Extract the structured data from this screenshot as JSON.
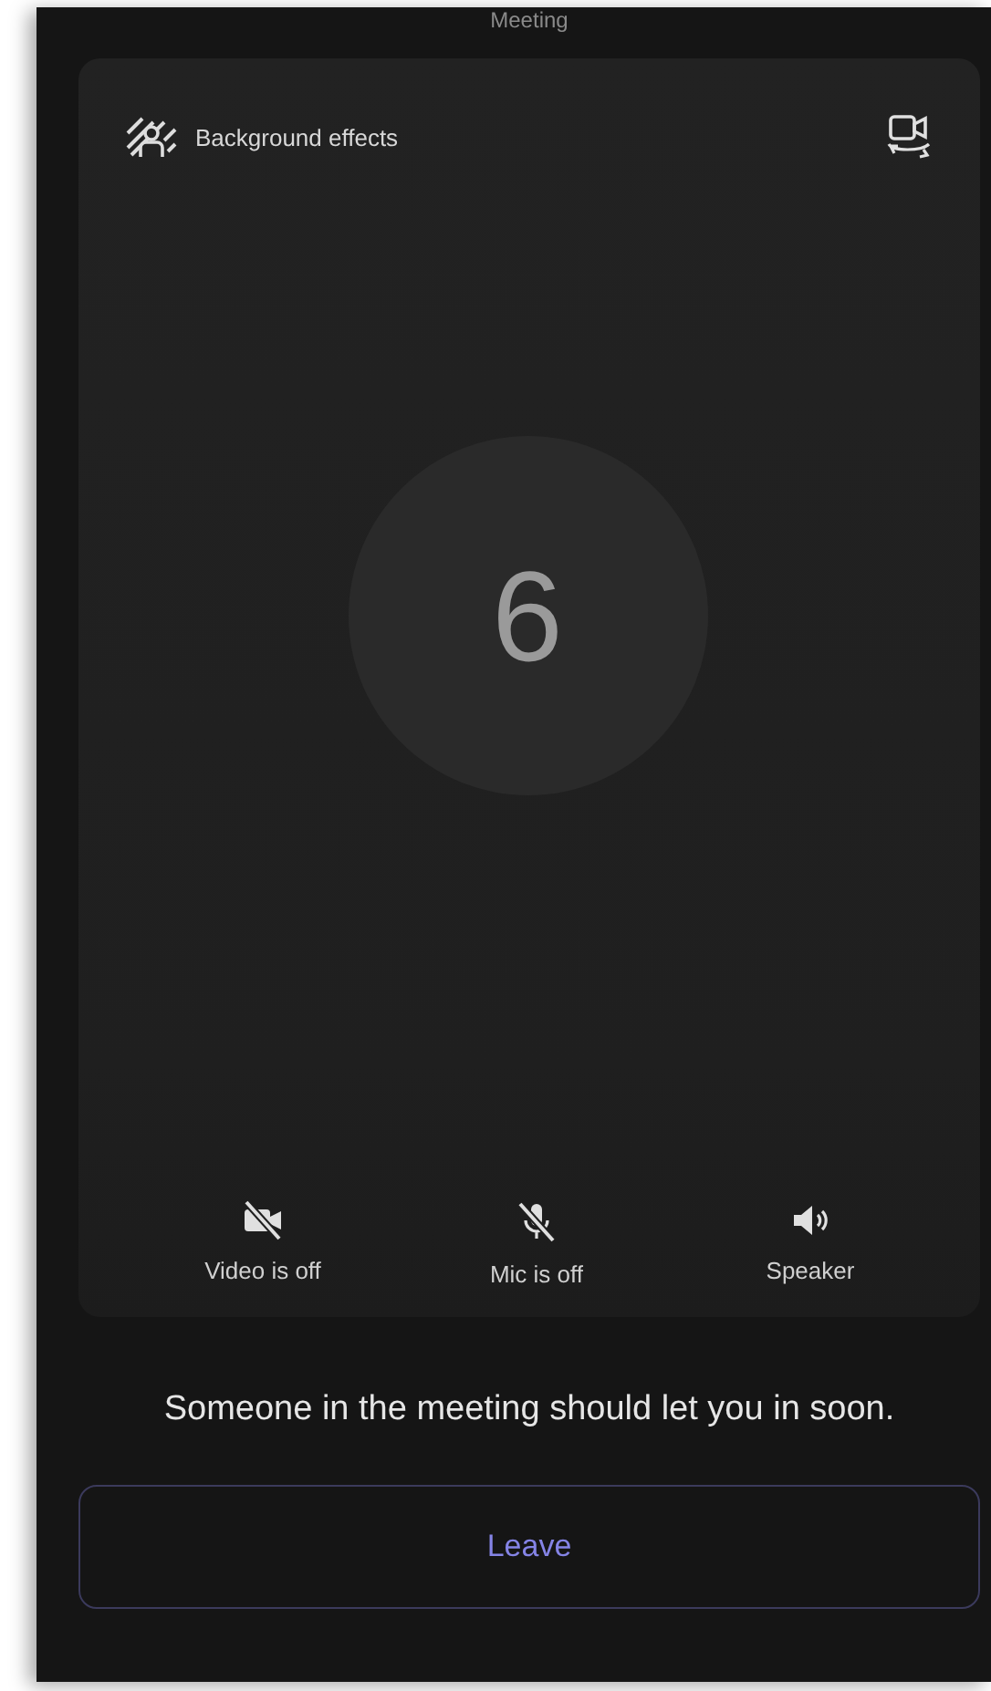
{
  "header": {
    "title": "Meeting"
  },
  "preview": {
    "background_effects": "Background effects",
    "avatar_text": "6"
  },
  "controls": [
    {
      "kind": "video",
      "label": "Video is off",
      "on": false
    },
    {
      "kind": "mic",
      "label": "Mic is off",
      "on": false
    },
    {
      "kind": "speaker",
      "label": "Speaker",
      "on": true
    }
  ],
  "message": "Someone in the meeting should let you in soon.",
  "leave_button": "Leave"
}
